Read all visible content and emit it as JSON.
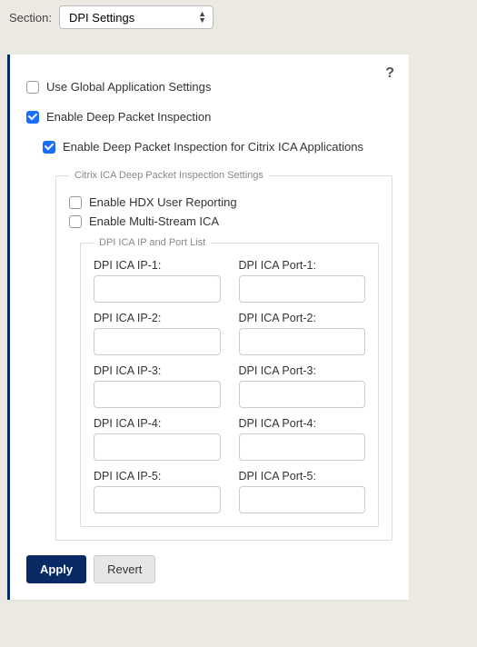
{
  "topbar": {
    "section_label": "Section:",
    "section_value": "DPI Settings"
  },
  "help_glyph": "?",
  "checkboxes": {
    "use_global": {
      "label": "Use Global Application Settings",
      "checked": false
    },
    "enable_dpi": {
      "label": "Enable Deep Packet Inspection",
      "checked": true
    },
    "enable_dpi_citrix": {
      "label": "Enable Deep Packet Inspection for Citrix ICA Applications",
      "checked": true
    },
    "enable_hdx": {
      "label": "Enable HDX User Reporting",
      "checked": false
    },
    "enable_multi_stream": {
      "label": "Enable Multi-Stream ICA",
      "checked": false
    }
  },
  "groups": {
    "citrix_legend": "Citrix ICA Deep Packet Inspection Settings",
    "ipport_legend": "DPI ICA IP and Port List"
  },
  "ip_port_rows": [
    {
      "ip_label": "DPI ICA IP-1:",
      "ip_value": "",
      "port_label": "DPI ICA Port-1:",
      "port_value": ""
    },
    {
      "ip_label": "DPI ICA IP-2:",
      "ip_value": "",
      "port_label": "DPI ICA Port-2:",
      "port_value": ""
    },
    {
      "ip_label": "DPI ICA IP-3:",
      "ip_value": "",
      "port_label": "DPI ICA Port-3:",
      "port_value": ""
    },
    {
      "ip_label": "DPI ICA IP-4:",
      "ip_value": "",
      "port_label": "DPI ICA Port-4:",
      "port_value": ""
    },
    {
      "ip_label": "DPI ICA IP-5:",
      "ip_value": "",
      "port_label": "DPI ICA Port-5:",
      "port_value": ""
    }
  ],
  "buttons": {
    "apply": "Apply",
    "revert": "Revert"
  }
}
